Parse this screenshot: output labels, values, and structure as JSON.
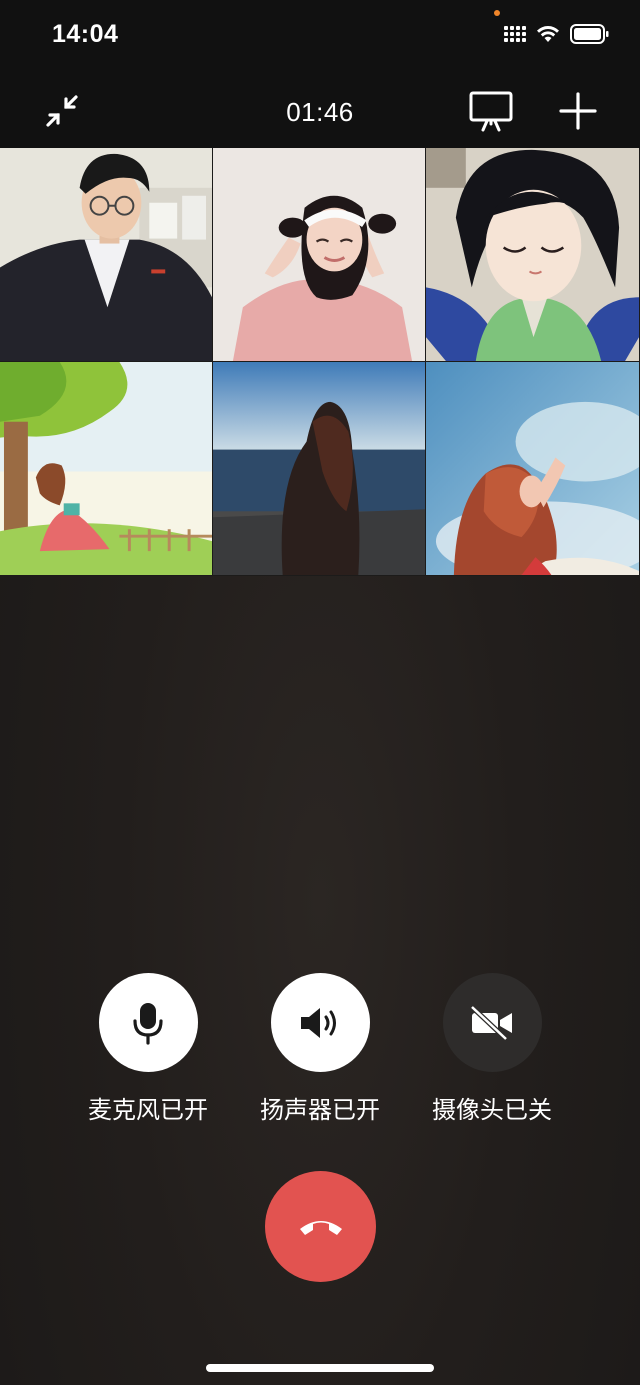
{
  "status_bar": {
    "time": "14:04"
  },
  "toolbar": {
    "call_duration": "01:46"
  },
  "icons": {
    "minimize": "minimize-arrows-icon",
    "screen_share": "screen-share-icon",
    "add": "plus-icon",
    "mic": "microphone-icon",
    "speaker": "speaker-icon",
    "camera": "camera-off-icon",
    "hangup": "phone-hangup-icon"
  },
  "participants": [
    {
      "id": "p1"
    },
    {
      "id": "p2"
    },
    {
      "id": "p3"
    },
    {
      "id": "p4"
    },
    {
      "id": "p5"
    },
    {
      "id": "p6"
    }
  ],
  "controls": {
    "mic_label": "麦克风已开",
    "speaker_label": "扬声器已开",
    "camera_label": "摄像头已关"
  },
  "colors": {
    "hangup": "#e25350",
    "control_on": "#ffffff",
    "control_off": "#2e2c2b",
    "status_dot": "#f0862a"
  }
}
